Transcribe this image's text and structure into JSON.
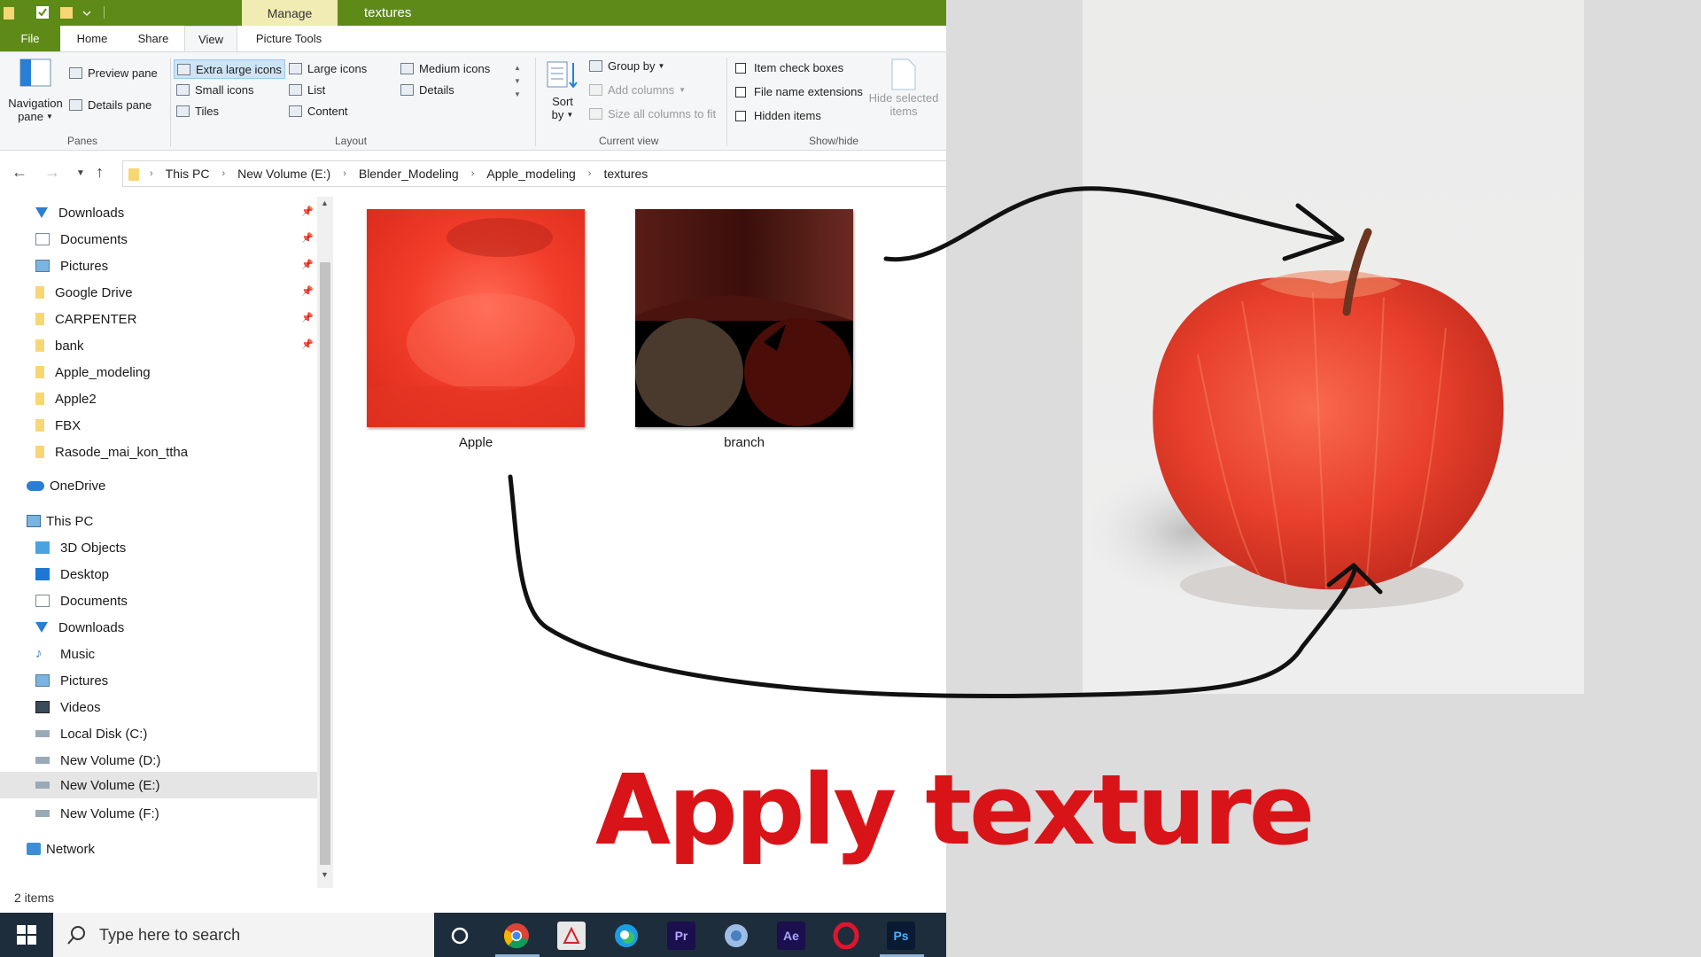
{
  "window": {
    "title": "textures",
    "contextual_tab": "Manage"
  },
  "tabs": {
    "file": "File",
    "home": "Home",
    "share": "Share",
    "view": "View",
    "picture_tools": "Picture Tools"
  },
  "ribbon": {
    "panes": {
      "navigation_pane": "Navigation",
      "navigation_pane_2": "pane",
      "preview_pane": "Preview pane",
      "details_pane": "Details pane",
      "label": "Panes"
    },
    "layout": {
      "extra_large_icons": "Extra large icons",
      "large_icons": "Large icons",
      "medium_icons": "Medium icons",
      "small_icons": "Small icons",
      "list": "List",
      "details": "Details",
      "tiles": "Tiles",
      "content": "Content",
      "label": "Layout"
    },
    "current_view": {
      "sort_by": "Sort",
      "sort_by_2": "by",
      "group_by": "Group by",
      "add_columns": "Add columns",
      "size_all_columns": "Size all columns to fit",
      "label": "Current view"
    },
    "show_hide": {
      "item_check_boxes": "Item check boxes",
      "file_name_extensions": "File name extensions",
      "hidden_items": "Hidden items",
      "hide_selected": "Hide selected",
      "hide_selected_2": "items",
      "label": "Show/hide"
    }
  },
  "breadcrumb": [
    "This PC",
    "New Volume (E:)",
    "Blender_Modeling",
    "Apple_modeling",
    "textures"
  ],
  "nav": {
    "quick_access": [
      "Downloads",
      "Documents",
      "Pictures",
      "Google Drive",
      "CARPENTER",
      "bank",
      "Apple_modeling",
      "Apple2",
      "FBX",
      "Rasode_mai_kon_ttha"
    ],
    "onedrive": "OneDrive",
    "this_pc": "This PC",
    "pc_items": [
      "3D Objects",
      "Desktop",
      "Documents",
      "Downloads",
      "Music",
      "Pictures",
      "Videos",
      "Local Disk (C:)",
      "New Volume (D:)",
      "New Volume (E:)",
      "New Volume (F:)"
    ],
    "network": "Network"
  },
  "files": [
    "Apple",
    "branch"
  ],
  "status": "2 items",
  "overlay_title": "Apply texture",
  "taskbar": {
    "search_placeholder": "Type here to search",
    "apps": [
      "Cortana",
      "Chrome",
      "Acrobat",
      "Edge",
      "Premiere Pro",
      "Chrome Profile",
      "After Effects",
      "Opera",
      "Photoshop"
    ],
    "pr_label": "Pr",
    "ae_label": "Ae",
    "ps_label": "Ps"
  },
  "colors": {
    "accent_green": "#5e8a18",
    "title_red": "#d91418",
    "taskbar": "#1d2d3b",
    "apple_red": "#e8402c"
  }
}
